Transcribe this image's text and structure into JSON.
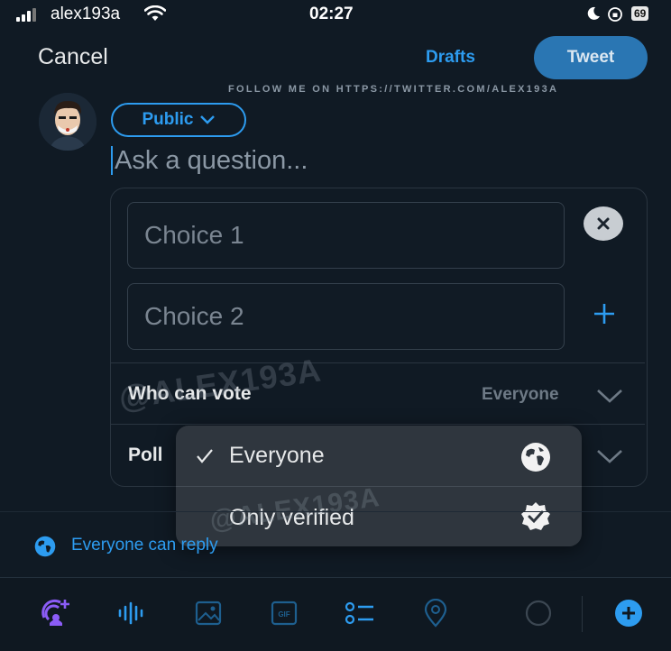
{
  "status_bar": {
    "carrier": "alex193a",
    "time": "02:27",
    "battery": "69"
  },
  "header": {
    "cancel_label": "Cancel",
    "drafts_label": "Drafts",
    "tweet_label": "Tweet",
    "watermark": "FOLLOW ME ON HTTPS://TWITTER.COM/ALEX193A"
  },
  "composer": {
    "audience_label": "Public",
    "question_placeholder": "Ask a question..."
  },
  "poll": {
    "choices": [
      {
        "placeholder": "Choice 1"
      },
      {
        "placeholder": "Choice 2"
      }
    ],
    "who_can_vote_label": "Who can vote",
    "who_can_vote_value": "Everyone",
    "poll_length_label": "Poll"
  },
  "dropdown": {
    "options": [
      {
        "label": "Everyone",
        "selected": true,
        "icon": "globe-icon"
      },
      {
        "label": "Only verified",
        "selected": false,
        "icon": "verified-badge-icon"
      }
    ]
  },
  "watermarks": {
    "overlay": "@ALEX193A"
  },
  "reply": {
    "label": "Everyone can reply"
  },
  "toolbar": {
    "icons": [
      "spaces-icon",
      "voice-icon",
      "image-icon",
      "gif-icon",
      "poll-icon",
      "location-icon",
      "char-count-ring",
      "add-thread-icon"
    ]
  },
  "colors": {
    "accent": "#2d9cf0",
    "background": "#101a24",
    "tweet_button": "#2a76b3",
    "spaces_purple": "#8b5cf6"
  }
}
